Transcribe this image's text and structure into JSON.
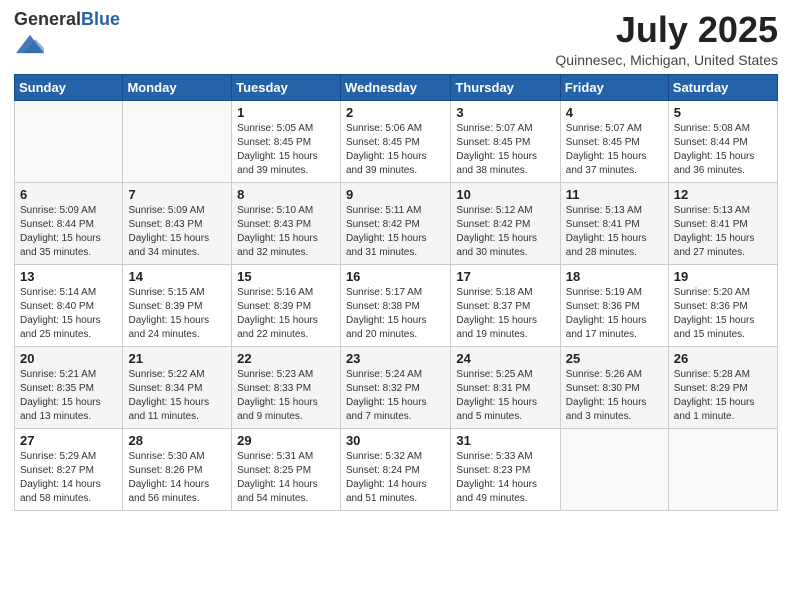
{
  "header": {
    "logo_general": "General",
    "logo_blue": "Blue",
    "month": "July 2025",
    "location": "Quinnesec, Michigan, United States"
  },
  "days_of_week": [
    "Sunday",
    "Monday",
    "Tuesday",
    "Wednesday",
    "Thursday",
    "Friday",
    "Saturday"
  ],
  "weeks": [
    [
      {
        "day": "",
        "sunrise": "",
        "sunset": "",
        "daylight": ""
      },
      {
        "day": "",
        "sunrise": "",
        "sunset": "",
        "daylight": ""
      },
      {
        "day": "1",
        "sunrise": "Sunrise: 5:05 AM",
        "sunset": "Sunset: 8:45 PM",
        "daylight": "Daylight: 15 hours and 39 minutes."
      },
      {
        "day": "2",
        "sunrise": "Sunrise: 5:06 AM",
        "sunset": "Sunset: 8:45 PM",
        "daylight": "Daylight: 15 hours and 39 minutes."
      },
      {
        "day": "3",
        "sunrise": "Sunrise: 5:07 AM",
        "sunset": "Sunset: 8:45 PM",
        "daylight": "Daylight: 15 hours and 38 minutes."
      },
      {
        "day": "4",
        "sunrise": "Sunrise: 5:07 AM",
        "sunset": "Sunset: 8:45 PM",
        "daylight": "Daylight: 15 hours and 37 minutes."
      },
      {
        "day": "5",
        "sunrise": "Sunrise: 5:08 AM",
        "sunset": "Sunset: 8:44 PM",
        "daylight": "Daylight: 15 hours and 36 minutes."
      }
    ],
    [
      {
        "day": "6",
        "sunrise": "Sunrise: 5:09 AM",
        "sunset": "Sunset: 8:44 PM",
        "daylight": "Daylight: 15 hours and 35 minutes."
      },
      {
        "day": "7",
        "sunrise": "Sunrise: 5:09 AM",
        "sunset": "Sunset: 8:43 PM",
        "daylight": "Daylight: 15 hours and 34 minutes."
      },
      {
        "day": "8",
        "sunrise": "Sunrise: 5:10 AM",
        "sunset": "Sunset: 8:43 PM",
        "daylight": "Daylight: 15 hours and 32 minutes."
      },
      {
        "day": "9",
        "sunrise": "Sunrise: 5:11 AM",
        "sunset": "Sunset: 8:42 PM",
        "daylight": "Daylight: 15 hours and 31 minutes."
      },
      {
        "day": "10",
        "sunrise": "Sunrise: 5:12 AM",
        "sunset": "Sunset: 8:42 PM",
        "daylight": "Daylight: 15 hours and 30 minutes."
      },
      {
        "day": "11",
        "sunrise": "Sunrise: 5:13 AM",
        "sunset": "Sunset: 8:41 PM",
        "daylight": "Daylight: 15 hours and 28 minutes."
      },
      {
        "day": "12",
        "sunrise": "Sunrise: 5:13 AM",
        "sunset": "Sunset: 8:41 PM",
        "daylight": "Daylight: 15 hours and 27 minutes."
      }
    ],
    [
      {
        "day": "13",
        "sunrise": "Sunrise: 5:14 AM",
        "sunset": "Sunset: 8:40 PM",
        "daylight": "Daylight: 15 hours and 25 minutes."
      },
      {
        "day": "14",
        "sunrise": "Sunrise: 5:15 AM",
        "sunset": "Sunset: 8:39 PM",
        "daylight": "Daylight: 15 hours and 24 minutes."
      },
      {
        "day": "15",
        "sunrise": "Sunrise: 5:16 AM",
        "sunset": "Sunset: 8:39 PM",
        "daylight": "Daylight: 15 hours and 22 minutes."
      },
      {
        "day": "16",
        "sunrise": "Sunrise: 5:17 AM",
        "sunset": "Sunset: 8:38 PM",
        "daylight": "Daylight: 15 hours and 20 minutes."
      },
      {
        "day": "17",
        "sunrise": "Sunrise: 5:18 AM",
        "sunset": "Sunset: 8:37 PM",
        "daylight": "Daylight: 15 hours and 19 minutes."
      },
      {
        "day": "18",
        "sunrise": "Sunrise: 5:19 AM",
        "sunset": "Sunset: 8:36 PM",
        "daylight": "Daylight: 15 hours and 17 minutes."
      },
      {
        "day": "19",
        "sunrise": "Sunrise: 5:20 AM",
        "sunset": "Sunset: 8:36 PM",
        "daylight": "Daylight: 15 hours and 15 minutes."
      }
    ],
    [
      {
        "day": "20",
        "sunrise": "Sunrise: 5:21 AM",
        "sunset": "Sunset: 8:35 PM",
        "daylight": "Daylight: 15 hours and 13 minutes."
      },
      {
        "day": "21",
        "sunrise": "Sunrise: 5:22 AM",
        "sunset": "Sunset: 8:34 PM",
        "daylight": "Daylight: 15 hours and 11 minutes."
      },
      {
        "day": "22",
        "sunrise": "Sunrise: 5:23 AM",
        "sunset": "Sunset: 8:33 PM",
        "daylight": "Daylight: 15 hours and 9 minutes."
      },
      {
        "day": "23",
        "sunrise": "Sunrise: 5:24 AM",
        "sunset": "Sunset: 8:32 PM",
        "daylight": "Daylight: 15 hours and 7 minutes."
      },
      {
        "day": "24",
        "sunrise": "Sunrise: 5:25 AM",
        "sunset": "Sunset: 8:31 PM",
        "daylight": "Daylight: 15 hours and 5 minutes."
      },
      {
        "day": "25",
        "sunrise": "Sunrise: 5:26 AM",
        "sunset": "Sunset: 8:30 PM",
        "daylight": "Daylight: 15 hours and 3 minutes."
      },
      {
        "day": "26",
        "sunrise": "Sunrise: 5:28 AM",
        "sunset": "Sunset: 8:29 PM",
        "daylight": "Daylight: 15 hours and 1 minute."
      }
    ],
    [
      {
        "day": "27",
        "sunrise": "Sunrise: 5:29 AM",
        "sunset": "Sunset: 8:27 PM",
        "daylight": "Daylight: 14 hours and 58 minutes."
      },
      {
        "day": "28",
        "sunrise": "Sunrise: 5:30 AM",
        "sunset": "Sunset: 8:26 PM",
        "daylight": "Daylight: 14 hours and 56 minutes."
      },
      {
        "day": "29",
        "sunrise": "Sunrise: 5:31 AM",
        "sunset": "Sunset: 8:25 PM",
        "daylight": "Daylight: 14 hours and 54 minutes."
      },
      {
        "day": "30",
        "sunrise": "Sunrise: 5:32 AM",
        "sunset": "Sunset: 8:24 PM",
        "daylight": "Daylight: 14 hours and 51 minutes."
      },
      {
        "day": "31",
        "sunrise": "Sunrise: 5:33 AM",
        "sunset": "Sunset: 8:23 PM",
        "daylight": "Daylight: 14 hours and 49 minutes."
      },
      {
        "day": "",
        "sunrise": "",
        "sunset": "",
        "daylight": ""
      },
      {
        "day": "",
        "sunrise": "",
        "sunset": "",
        "daylight": ""
      }
    ]
  ]
}
